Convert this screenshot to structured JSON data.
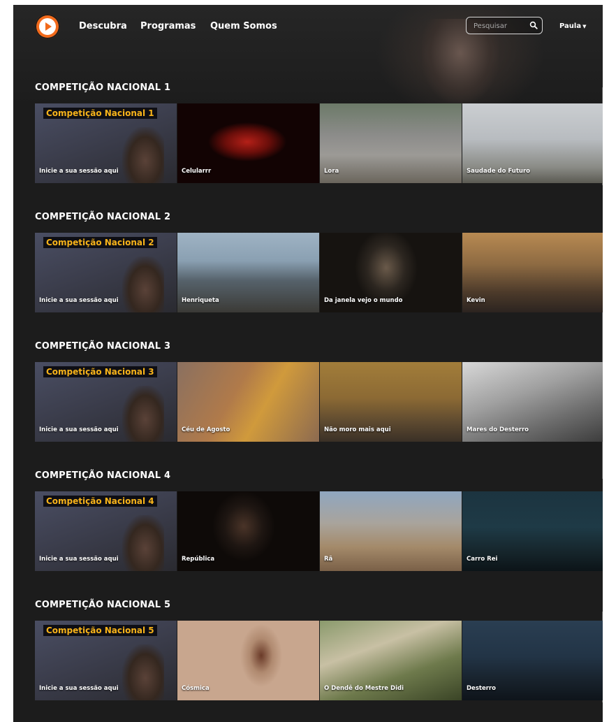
{
  "nav": {
    "links": [
      "Descubra",
      "Programas",
      "Quem Somos"
    ],
    "search_placeholder": "Pesquisar",
    "user": "Paula"
  },
  "colors": {
    "background": "#1c1c1c",
    "accent": "#f26a1b",
    "banner_text": "#f7b31a"
  },
  "sections": [
    {
      "title": "COMPETIÇÃO NACIONAL 1",
      "banner": "Competição Nacional 1",
      "tiles": [
        "Inicie a sua sessão aqui",
        "Celularrr",
        "Lora",
        "Saudade do Futuro"
      ]
    },
    {
      "title": "COMPETIÇÃO NACIONAL 2",
      "banner": "Competição Nacional 2",
      "tiles": [
        "Inicie a sua sessão aqui",
        "Henriqueta",
        "Da janela vejo o mundo",
        "Kevin"
      ]
    },
    {
      "title": "COMPETIÇÃO NACIONAL 3",
      "banner": "Competição Nacional 3",
      "tiles": [
        "Inicie a sua sessão aqui",
        "Céu de Agosto",
        "Não moro mais aqui",
        "Mares do Desterro"
      ]
    },
    {
      "title": "COMPETIÇÃO NACIONAL 4",
      "banner": "Competição Nacional 4",
      "tiles": [
        "Inicie a sua sessão aqui",
        "República",
        "Rã",
        "Carro Rei"
      ]
    },
    {
      "title": "COMPETIÇÃO NACIONAL 5",
      "banner": "Competição Nacional 5",
      "tiles": [
        "Inicie a sua sessão aqui",
        "Cósmica",
        "O Dendê do Mestre Didi",
        "Desterro"
      ]
    }
  ]
}
